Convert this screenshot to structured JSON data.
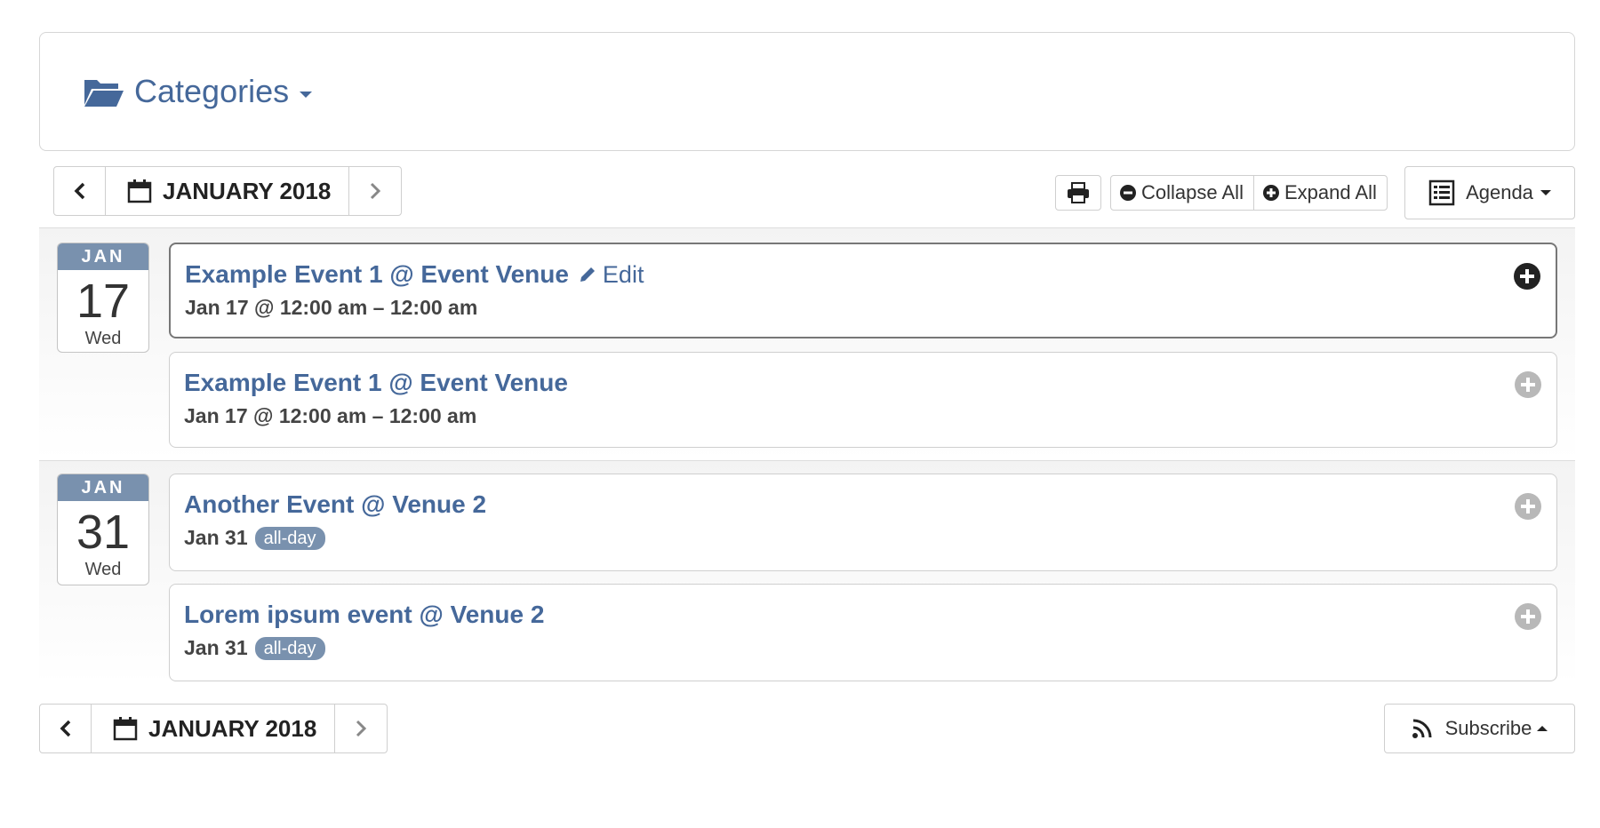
{
  "categories": {
    "label": "Categories"
  },
  "nav": {
    "month_label": "JANUARY 2018"
  },
  "toolbar": {
    "collapse_label": "Collapse All",
    "expand_label": "Expand All",
    "view_label": "Agenda"
  },
  "days": [
    {
      "month": "JAN",
      "day": "17",
      "weekday": "Wed",
      "events": [
        {
          "title": "Example Event 1 @ Event Venue",
          "edit_label": "Edit",
          "time": "Jan 17 @ 12:00 am – 12:00 am"
        },
        {
          "title": "Example Event 1 @ Event Venue",
          "time": "Jan 17 @ 12:00 am – 12:00 am"
        }
      ]
    },
    {
      "month": "JAN",
      "day": "31",
      "weekday": "Wed",
      "events": [
        {
          "title": "Another Event @ Venue 2",
          "time": "Jan 31",
          "badge": "all-day"
        },
        {
          "title": "Lorem ipsum event @ Venue 2",
          "time": "Jan 31",
          "badge": "all-day"
        }
      ]
    }
  ],
  "footer": {
    "month_label": "JANUARY 2018",
    "subscribe_label": "Subscribe"
  },
  "colors": {
    "link": "#45689a",
    "badge": "#7991ae"
  }
}
